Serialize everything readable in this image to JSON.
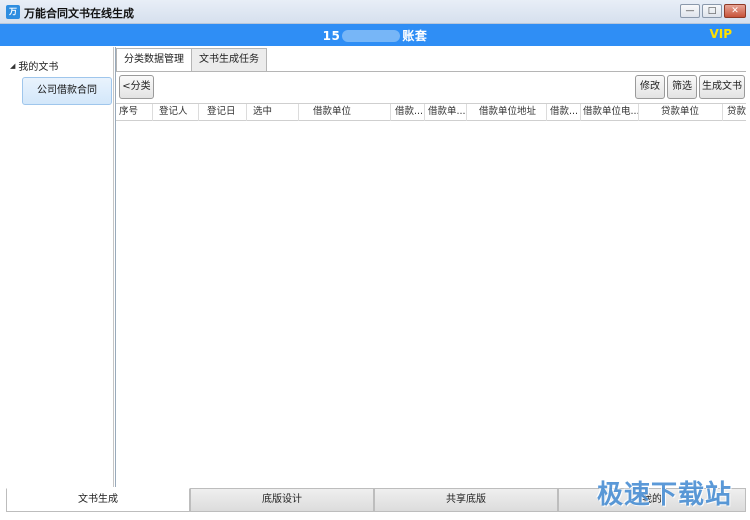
{
  "window": {
    "title": "万能合同文书在线生成",
    "icon": "app-logo-icon",
    "buttons": {
      "minimize": "—",
      "maximize": "□",
      "close": "✕"
    }
  },
  "header": {
    "account_prefix": "15",
    "account_suffix": "账套",
    "vip": "VIP",
    "accent_color": "#2f8ef5"
  },
  "tree": {
    "root": "我的文书",
    "children": [
      "公司借款合同"
    ]
  },
  "tabs": [
    "分类数据管理",
    "文书生成任务"
  ],
  "toolbar": {
    "back": "<分类",
    "edit": "修改",
    "filter": "筛选",
    "generate": "生成文书"
  },
  "grid": {
    "columns": [
      "序号",
      "登记人",
      "登记日",
      "选中",
      "借款单位",
      "借款...",
      "借款单...",
      "借款单位地址",
      "借款...",
      "借款单位电...",
      "贷款单位",
      "贷款"
    ]
  },
  "bottom_tabs": [
    "文书生成",
    "底版设计",
    "共享底版",
    "我的"
  ],
  "watermark": "极速下载站"
}
